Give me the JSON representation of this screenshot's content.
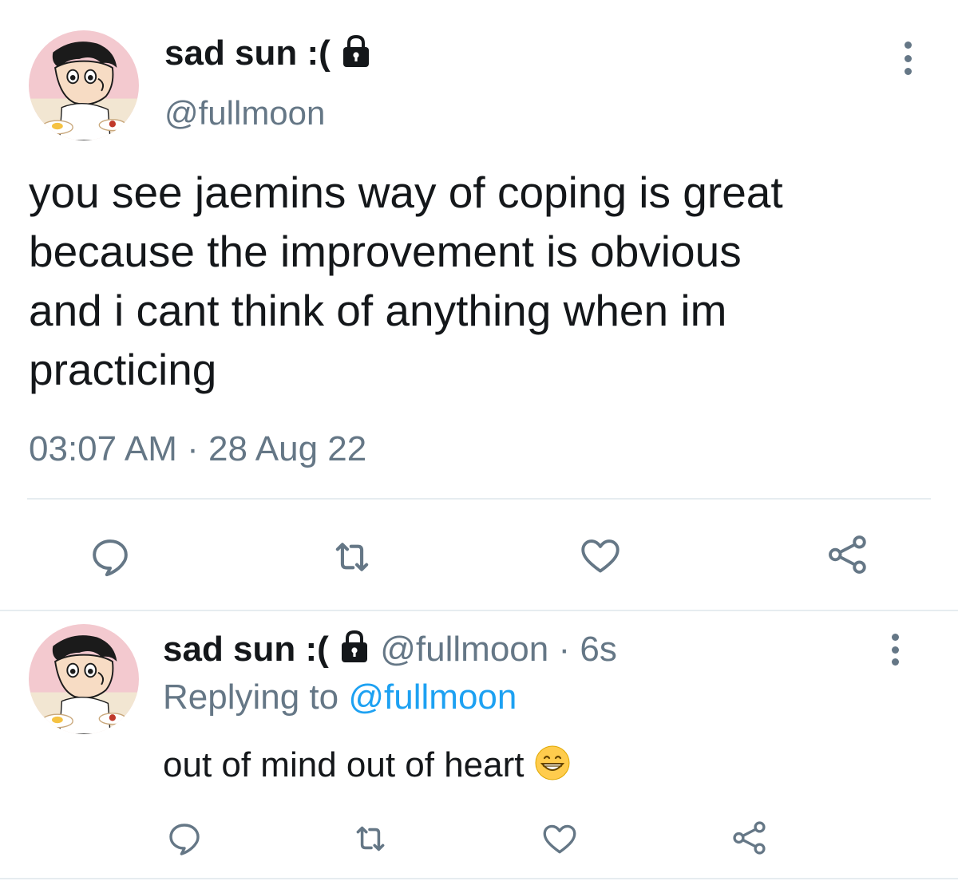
{
  "main_tweet": {
    "display_name": "sad sun :(",
    "handle": "@fullmoon",
    "text": "you see jaemins way of coping is great\nbecause the improvement is obvious\nand i cant think of anything when im\npracticing",
    "time": "03:07 AM",
    "separator": "·",
    "date": "28 Aug 22",
    "lock_icon": "lock-icon",
    "more_icon": "more-vertical-icon",
    "actions": [
      "reply-icon",
      "retweet-icon",
      "like-icon",
      "share-icon"
    ]
  },
  "reply_tweet": {
    "display_name": "sad sun :(",
    "handle": "@fullmoon",
    "separator": "·",
    "age": "6s",
    "replying_prefix": "Replying to",
    "replying_handle": "@fullmoon",
    "text": "out of mind out of heart",
    "emoji": "grinning-face-emoji",
    "lock_icon": "lock-icon",
    "more_icon": "more-vertical-icon",
    "actions": [
      "reply-icon",
      "retweet-icon",
      "like-icon",
      "share-icon"
    ]
  },
  "colors": {
    "text": "#14171a",
    "secondary": "#657786",
    "link": "#1da1f2",
    "divider": "#e6ecf0"
  }
}
